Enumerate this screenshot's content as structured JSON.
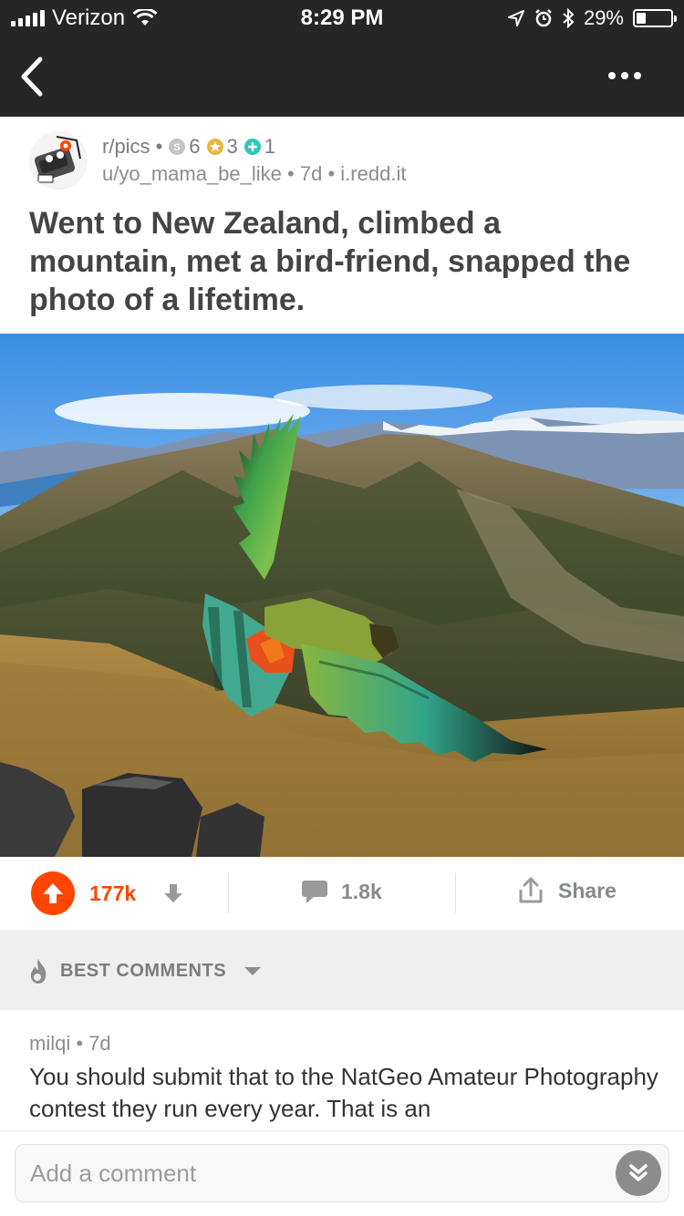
{
  "status_bar": {
    "carrier": "Verizon",
    "time": "8:29 PM",
    "battery": "29%",
    "battery_level": 0.29
  },
  "post": {
    "subreddit": "r/pics",
    "awards": [
      {
        "icon": "silver-award-icon",
        "count": "6",
        "color": "#c4c4c4"
      },
      {
        "icon": "gold-award-icon",
        "count": "3",
        "color": "#e5b73b"
      },
      {
        "icon": "platinum-award-icon",
        "count": "1",
        "color": "#2cc9b5"
      }
    ],
    "author": "u/yo_mama_be_like",
    "age": "7d",
    "domain": "i.redd.it",
    "separator": "•",
    "title": "Went to New Zealand, climbed a mountain, met a bird-friend, snapped the photo of a lifetime."
  },
  "actions": {
    "score": "177k",
    "comments": "1.8k",
    "share_label": "Share",
    "accent": "#ff4500"
  },
  "sort": {
    "label": "BEST COMMENTS"
  },
  "comment": {
    "author": "milqi",
    "age": "7d",
    "meta": "milqi • 7d",
    "body": "You should submit that to the NatGeo Amateur Photography contest they run every year.  That is an"
  },
  "composer": {
    "placeholder": "Add a comment"
  }
}
